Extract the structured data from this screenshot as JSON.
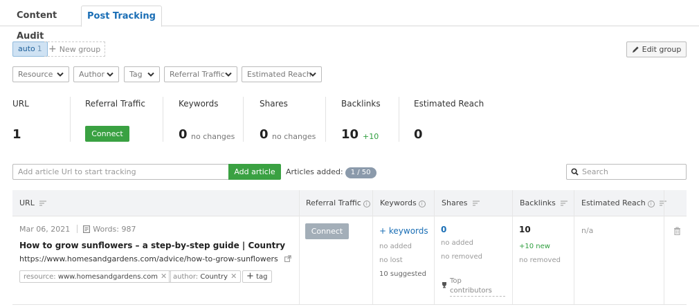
{
  "tabs": [
    {
      "label": "Content Audit",
      "active": false
    },
    {
      "label": "Post Tracking",
      "active": true
    }
  ],
  "groups": {
    "active_name": "auto",
    "active_count": "1",
    "new_group_label": "New group",
    "edit_group_label": "Edit group"
  },
  "filters": [
    "Resource",
    "Author",
    "Tag",
    "Referral Traffic",
    "Estimated Reach"
  ],
  "stats": {
    "url": {
      "label": "URL",
      "value": "1"
    },
    "referral": {
      "label": "Referral Traffic",
      "button": "Connect"
    },
    "keywords": {
      "label": "Keywords",
      "value": "0",
      "sub": "no changes"
    },
    "shares": {
      "label": "Shares",
      "value": "0",
      "sub": "no changes"
    },
    "backlinks": {
      "label": "Backlinks",
      "value": "10",
      "sub": "+10"
    },
    "reach": {
      "label": "Estimated Reach",
      "value": "0"
    }
  },
  "add_article": {
    "placeholder": "Add article Url to start tracking",
    "button": "Add article",
    "added_label": "Articles added:",
    "added_value": "1 / 50"
  },
  "search": {
    "placeholder": "Search"
  },
  "table": {
    "headers": {
      "url": "URL",
      "referral": "Referral Traffic",
      "keywords": "Keywords",
      "shares": "Shares",
      "backlinks": "Backlinks",
      "reach": "Estimated Reach"
    },
    "row": {
      "date": "Mar 06, 2021",
      "words": "Words: 987",
      "title": "How to grow sunflowers – a step-by-step guide | Country",
      "url": "https://www.homesandgardens.com/advice/how-to-grow-sunflowers",
      "tags": [
        {
          "key": "resource:",
          "value": "www.homesandgardens.com"
        },
        {
          "key": "author:",
          "value": "Country"
        }
      ],
      "add_tag": "tag",
      "referral_button": "Connect",
      "keywords": {
        "link": "+ keywords",
        "added": "no added",
        "lost": "no lost",
        "suggested": "10 suggested"
      },
      "shares": {
        "value": "0",
        "added": "no added",
        "removed": "no removed",
        "top": "Top contributors"
      },
      "backlinks": {
        "value": "10",
        "new": "+10 new",
        "removed": "no removed"
      },
      "reach": "n/a"
    }
  }
}
